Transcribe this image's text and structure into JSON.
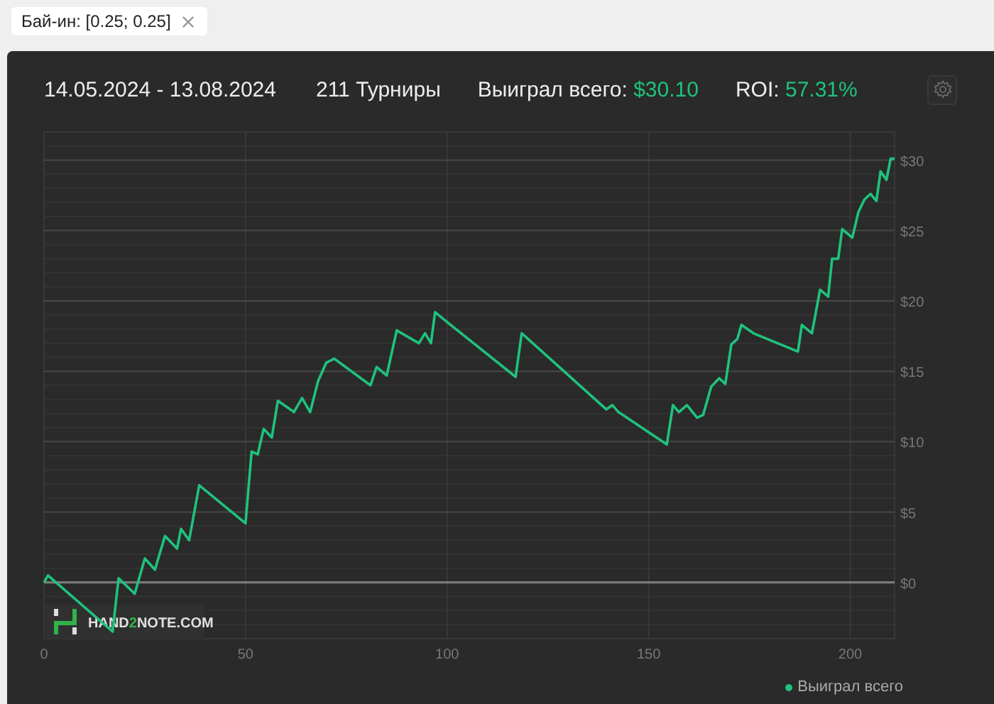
{
  "filter_chip": {
    "label": "Бай-ин: [0.25; 0.25]"
  },
  "summary": {
    "date_range": "14.05.2024 - 13.08.2024",
    "tournaments": "211 Турниры",
    "won_label": "Выиграл всего:",
    "won_value": "$30.10",
    "roi_label": "ROI:",
    "roi_value": "57.31%"
  },
  "chart": {
    "logo_parts": [
      "HAND",
      "2",
      "NOTE.COM"
    ],
    "chart_data": {
      "type": "line",
      "x": [
        0,
        1,
        17,
        18.5,
        22.5,
        25,
        27.5,
        30,
        33,
        34,
        36,
        38.5,
        50,
        51.5,
        53,
        54.5,
        56.5,
        58,
        62,
        64,
        66,
        68,
        70,
        72,
        81,
        82.5,
        85,
        87.5,
        93,
        94.5,
        96,
        97,
        100,
        117,
        118.5,
        139.5,
        141,
        142.5,
        154.5,
        156,
        157.5,
        159.5,
        162,
        163.5,
        165.5,
        167.5,
        169,
        170.5,
        172,
        173,
        176,
        187,
        188,
        190.5,
        192.5,
        194.5,
        195.5,
        197,
        198,
        200.5,
        202,
        203.5,
        205,
        206.5,
        207.5,
        209,
        210,
        211
      ],
      "series": [
        {
          "name": "Выиграл всего",
          "color": "#1fc27d",
          "values": [
            0,
            0.5,
            -3.5,
            0.3,
            -0.8,
            1.7,
            0.9,
            3.3,
            2.4,
            3.8,
            3,
            6.9,
            4.2,
            9.3,
            9.1,
            10.9,
            10.3,
            12.9,
            12.1,
            13.1,
            12.1,
            14.3,
            15.6,
            15.9,
            14,
            15.3,
            14.7,
            17.9,
            17,
            17.7,
            17,
            19.2,
            18.5,
            14.6,
            17.7,
            12.3,
            12.6,
            12.1,
            9.8,
            12.6,
            12.1,
            12.6,
            11.7,
            11.9,
            13.9,
            14.5,
            14.1,
            16.9,
            17.3,
            18.3,
            17.7,
            16.4,
            18.3,
            17.7,
            20.8,
            20.3,
            23,
            23,
            25.1,
            24.5,
            26.3,
            27.2,
            27.6,
            27.1,
            29.2,
            28.6,
            30.1,
            30.1
          ]
        }
      ],
      "xlim": [
        0,
        211
      ],
      "grid": true,
      "ylim": [
        -4,
        32
      ],
      "xticks": [
        0,
        50,
        100,
        150,
        200
      ],
      "yticks": [
        {
          "value": 0,
          "label": "$0"
        },
        {
          "value": 5,
          "label": "$5"
        },
        {
          "value": 10,
          "label": "$10"
        },
        {
          "value": 15,
          "label": "$15"
        },
        {
          "value": 20,
          "label": "$20"
        },
        {
          "value": 25,
          "label": "$25"
        },
        {
          "value": 30,
          "label": "$30"
        }
      ]
    }
  }
}
